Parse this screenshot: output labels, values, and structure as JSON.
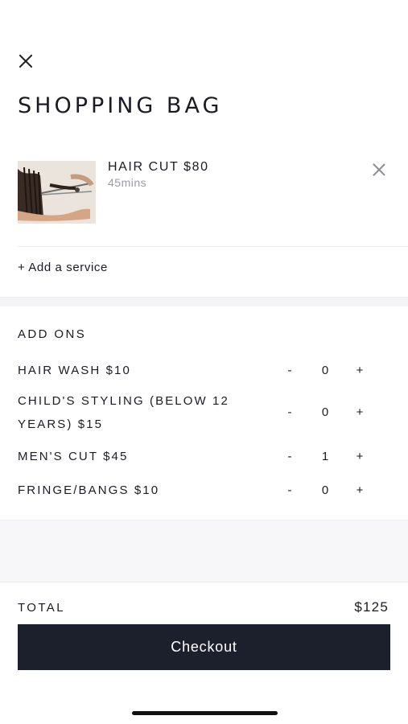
{
  "header": {
    "close_icon": "close-icon",
    "title": "SHOPPING BAG"
  },
  "bag_item": {
    "name": "HAIR CUT $80",
    "duration": "45mins",
    "remove_icon": "close-icon"
  },
  "add_service_label": "+ Add a service",
  "addons": {
    "title": "ADD ONS",
    "items": [
      {
        "label": "HAIR WASH  $10",
        "quantity": "0",
        "minus": "-",
        "plus": "+"
      },
      {
        "label": "CHILD'S STYLING (BELOW 12 YEARS)  $15",
        "quantity": "0",
        "minus": "-",
        "plus": "+"
      },
      {
        "label": "MEN'S CUT  $45",
        "quantity": "1",
        "minus": "-",
        "plus": "+"
      },
      {
        "label": "FRINGE/BANGS  $10",
        "quantity": "0",
        "minus": "-",
        "plus": "+"
      }
    ]
  },
  "total": {
    "label": "TOTAL",
    "value": "$125"
  },
  "checkout_label": "Checkout",
  "colors": {
    "button_bg": "#1c202d",
    "text": "#1b1b24",
    "muted": "#9c9ca3"
  }
}
